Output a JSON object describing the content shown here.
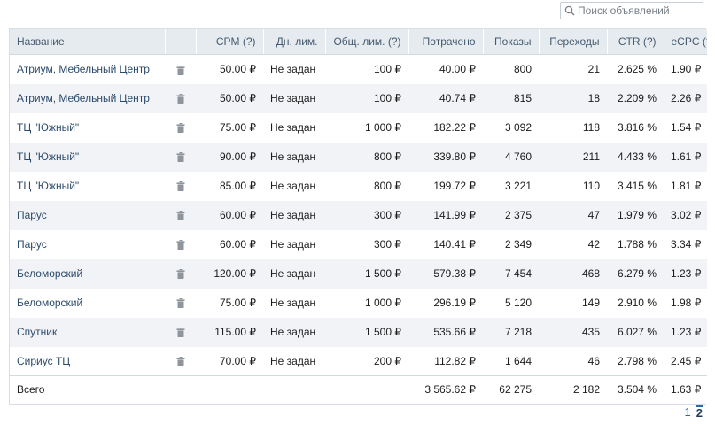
{
  "search": {
    "placeholder": "Поиск объявлений",
    "value": ""
  },
  "table": {
    "headers": [
      "Название",
      "",
      "CPM (?)",
      "Дн. лим.",
      "Общ. лим. (?)",
      "Потрачено",
      "Показы",
      "Переходы",
      "CTR (?)",
      "eCPC (?)"
    ],
    "rows": [
      {
        "name": "Атриум, Мебельный Центр",
        "cpm": "50.00 ₽",
        "daily": "Не задан",
        "total": "100 ₽",
        "spent": "40.00 ₽",
        "views": "800",
        "clicks": "21",
        "ctr": "2.625 %",
        "ecpc": "1.90 ₽"
      },
      {
        "name": "Атриум, Мебельный Центр",
        "cpm": "50.00 ₽",
        "daily": "Не задан",
        "total": "100 ₽",
        "spent": "40.74 ₽",
        "views": "815",
        "clicks": "18",
        "ctr": "2.209 %",
        "ecpc": "2.26 ₽"
      },
      {
        "name": "ТЦ \"Южный\"",
        "cpm": "75.00 ₽",
        "daily": "Не задан",
        "total": "1 000 ₽",
        "spent": "182.22 ₽",
        "views": "3 092",
        "clicks": "118",
        "ctr": "3.816 %",
        "ecpc": "1.54 ₽"
      },
      {
        "name": "ТЦ \"Южный\"",
        "cpm": "90.00 ₽",
        "daily": "Не задан",
        "total": "800 ₽",
        "spent": "339.80 ₽",
        "views": "4 760",
        "clicks": "211",
        "ctr": "4.433 %",
        "ecpc": "1.61 ₽"
      },
      {
        "name": "ТЦ \"Южный\"",
        "cpm": "85.00 ₽",
        "daily": "Не задан",
        "total": "800 ₽",
        "spent": "199.72 ₽",
        "views": "3 221",
        "clicks": "110",
        "ctr": "3.415 %",
        "ecpc": "1.81 ₽"
      },
      {
        "name": "Парус",
        "cpm": "60.00 ₽",
        "daily": "Не задан",
        "total": "300 ₽",
        "spent": "141.99 ₽",
        "views": "2 375",
        "clicks": "47",
        "ctr": "1.979 %",
        "ecpc": "3.02 ₽"
      },
      {
        "name": "Парус",
        "cpm": "60.00 ₽",
        "daily": "Не задан",
        "total": "300 ₽",
        "spent": "140.41 ₽",
        "views": "2 349",
        "clicks": "42",
        "ctr": "1.788 %",
        "ecpc": "3.34 ₽"
      },
      {
        "name": "Беломорский",
        "cpm": "120.00 ₽",
        "daily": "Не задан",
        "total": "1 500 ₽",
        "spent": "579.38 ₽",
        "views": "7 454",
        "clicks": "468",
        "ctr": "6.279 %",
        "ecpc": "1.23 ₽"
      },
      {
        "name": "Беломорский",
        "cpm": "75.00 ₽",
        "daily": "Не задан",
        "total": "1 000 ₽",
        "spent": "296.19 ₽",
        "views": "5 120",
        "clicks": "149",
        "ctr": "2.910 %",
        "ecpc": "1.98 ₽"
      },
      {
        "name": "Спутник",
        "cpm": "115.00 ₽",
        "daily": "Не задан",
        "total": "1 500 ₽",
        "spent": "535.66 ₽",
        "views": "7 218",
        "clicks": "435",
        "ctr": "6.027 %",
        "ecpc": "1.23 ₽"
      },
      {
        "name": "Сириус ТЦ",
        "cpm": "70.00 ₽",
        "daily": "Не задан",
        "total": "200 ₽",
        "spent": "112.82 ₽",
        "views": "1 644",
        "clicks": "46",
        "ctr": "2.798 %",
        "ecpc": "2.45 ₽"
      }
    ],
    "row_action_icon": "trash-icon",
    "totals": {
      "label": "Всего",
      "spent": "3 565.62 ₽",
      "views": "62 275",
      "clicks": "2 182",
      "ctr": "3.504 %",
      "ecpc": "1.63 ₽"
    }
  },
  "pagination": {
    "pages": [
      "1",
      "2"
    ],
    "current": "2"
  },
  "colors": {
    "header_bg": "#e6ebf0",
    "stripe_bg": "#f1f3f6",
    "link": "#2c4b6b",
    "accent": "#2a6aa8"
  }
}
